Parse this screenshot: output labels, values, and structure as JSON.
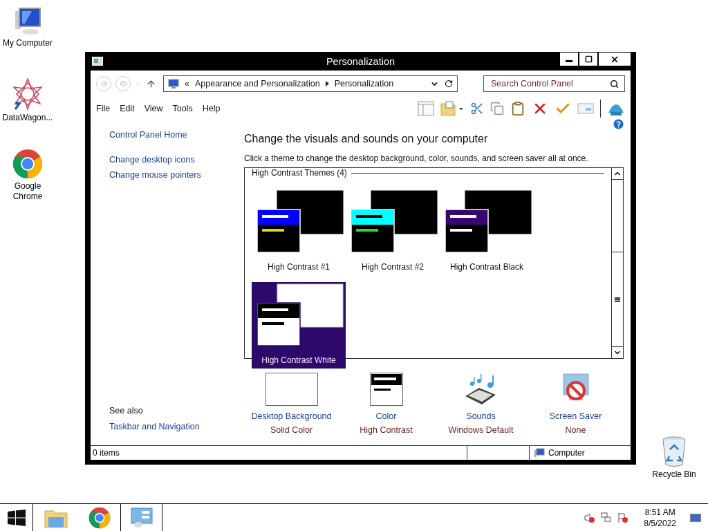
{
  "desktop_icons": [
    {
      "label": "My Computer",
      "kind": "computer"
    },
    {
      "label": "DataWagon...",
      "kind": "star"
    },
    {
      "label": "Google Chrome",
      "kind": "chrome"
    },
    {
      "label": "Recycle Bin",
      "kind": "bin"
    }
  ],
  "window": {
    "title": "Personalization"
  },
  "address_bar": {
    "separator": "«",
    "crumbs": [
      "Appearance and Personalization",
      "Personalization"
    ]
  },
  "search": {
    "placeholder": "Search Control Panel"
  },
  "menu": [
    "File",
    "Edit",
    "View",
    "Tools",
    "Help"
  ],
  "sidebar": {
    "links": [
      "Control Panel Home",
      "Change desktop icons",
      "Change mouse pointers"
    ],
    "see_also_title": "See also",
    "see_also": [
      "Taskbar and Navigation"
    ]
  },
  "heading": "Change the visuals and sounds on your computer",
  "subtitle": "Click a theme to change the desktop background, color, sounds, and screen saver all at once.",
  "theme_group": {
    "title": "High Contrast Themes (4)",
    "themes": [
      {
        "name": "High Contrast #1",
        "selected": false,
        "kind": "dark",
        "color": "#0000ff",
        "bars": [
          {
            "color": "#ffffff"
          },
          {
            "color": "#e0d020"
          }
        ]
      },
      {
        "name": "High Contrast #2",
        "selected": false,
        "kind": "dark",
        "color": "#00ffff",
        "bars": [
          {
            "color": "#000000"
          },
          {
            "color": "#20e020"
          }
        ]
      },
      {
        "name": "High Contrast Black",
        "selected": false,
        "kind": "dark",
        "color": "#37066e",
        "bars": [
          {
            "color": "#ffffff"
          },
          {
            "color": "#ffffff"
          }
        ]
      },
      {
        "name": "High Contrast White",
        "selected": true,
        "kind": "light",
        "color": "#000000",
        "bars": [
          {
            "color": "#ffffff"
          },
          {
            "color": "#000000"
          }
        ]
      }
    ]
  },
  "settings": [
    {
      "label": "Desktop Background",
      "value": "Solid Color",
      "kind": "background"
    },
    {
      "label": "Color",
      "value": "High Contrast",
      "kind": "color"
    },
    {
      "label": "Sounds",
      "value": "Windows Default",
      "kind": "sounds"
    },
    {
      "label": "Screen Saver",
      "value": "None",
      "kind": "screensaver"
    }
  ],
  "status_bar": {
    "count": "0 items",
    "location": "Computer"
  },
  "taskbar": {
    "time": "8:51 AM",
    "date": "8/5/2022"
  }
}
